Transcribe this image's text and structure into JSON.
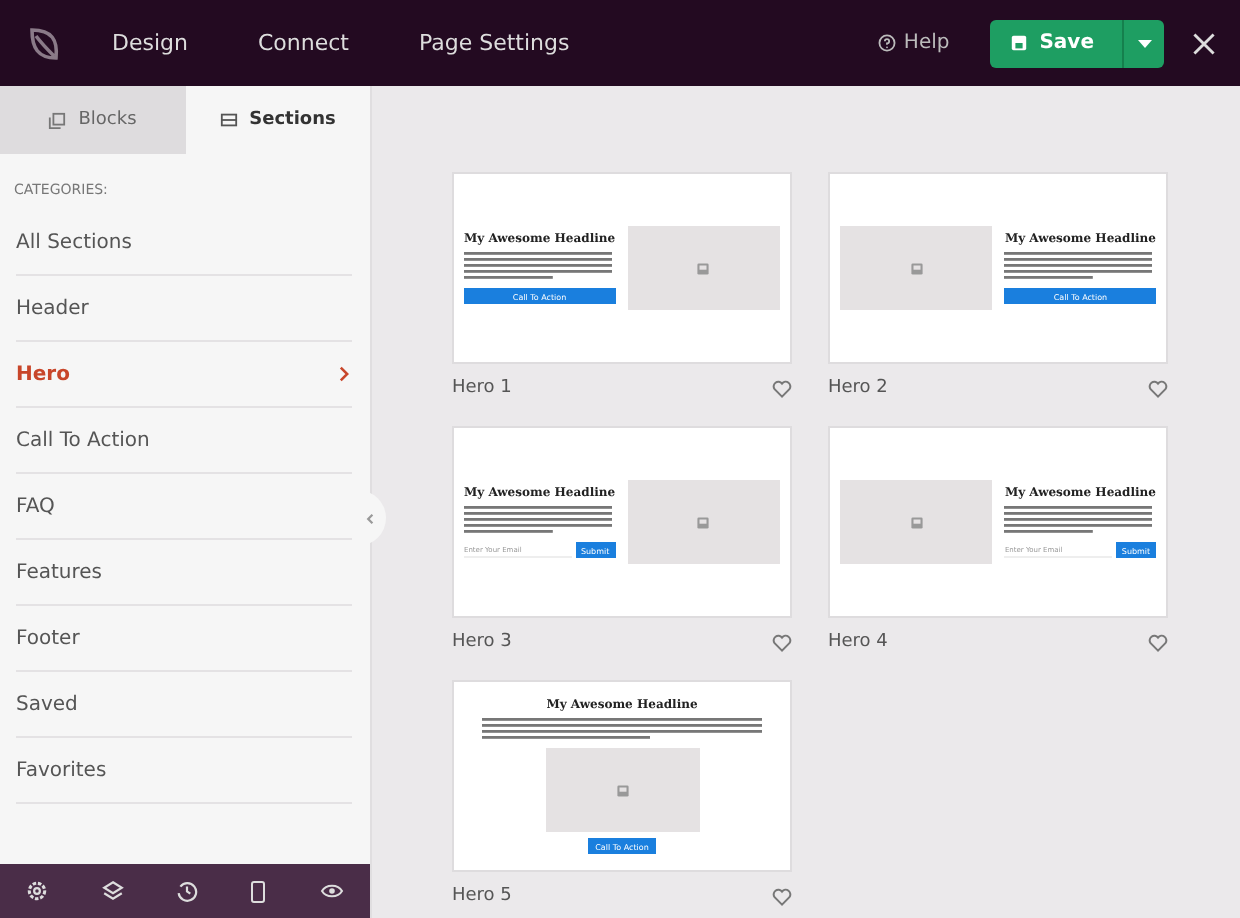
{
  "topbar": {
    "nav": [
      {
        "label": "Design"
      },
      {
        "label": "Connect"
      },
      {
        "label": "Page Settings"
      }
    ],
    "help": "Help",
    "save": "Save"
  },
  "sidebar": {
    "tabs": [
      {
        "label": "Blocks",
        "selected": false
      },
      {
        "label": "Sections",
        "selected": true
      }
    ],
    "heading": "CATEGORIES:",
    "items": [
      {
        "label": "All Sections",
        "selected": false
      },
      {
        "label": "Header",
        "selected": false
      },
      {
        "label": "Hero",
        "selected": true
      },
      {
        "label": "Call To Action",
        "selected": false
      },
      {
        "label": "FAQ",
        "selected": false
      },
      {
        "label": "Features",
        "selected": false
      },
      {
        "label": "Footer",
        "selected": false
      },
      {
        "label": "Saved",
        "selected": false
      },
      {
        "label": "Favorites",
        "selected": false
      }
    ]
  },
  "sections": [
    {
      "label": "Hero 1",
      "kind": "text-left",
      "headline": "My Awesome Headline",
      "button": "Call To Action"
    },
    {
      "label": "Hero 2",
      "kind": "image-left",
      "headline": "My Awesome Headline",
      "button": "Call To Action"
    },
    {
      "label": "Hero 3",
      "kind": "text-left",
      "headline": "My Awesome Headline",
      "placeholder": "Enter Your Email",
      "button": "Submit"
    },
    {
      "label": "Hero 4",
      "kind": "image-left",
      "headline": "My Awesome Headline",
      "placeholder": "Enter Your Email",
      "button": "Submit"
    },
    {
      "label": "Hero 5",
      "kind": "centered",
      "headline": "My Awesome Headline",
      "button": "Call To Action"
    }
  ]
}
